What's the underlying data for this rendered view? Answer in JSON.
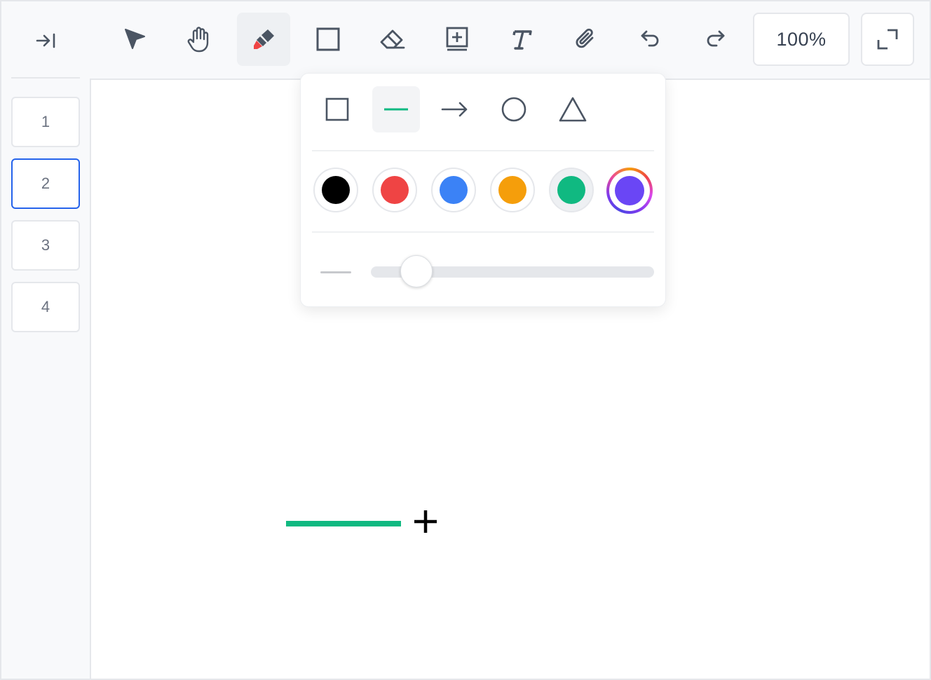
{
  "sidebar": {
    "collapse_icon": "collapse-right-icon",
    "pages": [
      {
        "label": "1",
        "active": false
      },
      {
        "label": "2",
        "active": true
      },
      {
        "label": "3",
        "active": false
      },
      {
        "label": "4",
        "active": false
      }
    ]
  },
  "toolbar": {
    "tools": [
      {
        "name": "select",
        "icon": "cursor-arrow-icon"
      },
      {
        "name": "pan",
        "icon": "hand-icon"
      },
      {
        "name": "marker",
        "icon": "marker-icon",
        "active": true
      },
      {
        "name": "shape",
        "icon": "square-icon"
      },
      {
        "name": "eraser",
        "icon": "eraser-icon"
      },
      {
        "name": "add-page",
        "icon": "add-page-icon"
      },
      {
        "name": "text",
        "icon": "text-icon"
      },
      {
        "name": "attach",
        "icon": "paperclip-icon"
      },
      {
        "name": "undo",
        "icon": "undo-icon"
      },
      {
        "name": "redo",
        "icon": "redo-icon"
      }
    ],
    "zoom_label": "100%",
    "fullscreen_icon": "expand-icon"
  },
  "shape_popover": {
    "shapes": [
      {
        "name": "rectangle",
        "icon": "square-icon"
      },
      {
        "name": "line",
        "icon": "line-icon",
        "selected": true
      },
      {
        "name": "arrow",
        "icon": "arrow-right-icon"
      },
      {
        "name": "ellipse",
        "icon": "circle-icon"
      },
      {
        "name": "triangle",
        "icon": "triangle-icon"
      }
    ],
    "colors": [
      {
        "name": "black",
        "hex": "#000000"
      },
      {
        "name": "red",
        "hex": "#ef4444"
      },
      {
        "name": "blue",
        "hex": "#3b82f6"
      },
      {
        "name": "orange",
        "hex": "#f59e0b"
      },
      {
        "name": "green",
        "hex": "#10b981",
        "selected": true
      },
      {
        "name": "custom",
        "hex": "#6a46f5"
      }
    ],
    "stroke_width_fraction": 0.16
  },
  "canvas": {
    "line_color": "#10b981",
    "cursor_icon": "crosshair-icon"
  },
  "colors": {
    "accent": "#2563eb",
    "icon": "#4b5563",
    "marker_tip": "#ef4444"
  }
}
